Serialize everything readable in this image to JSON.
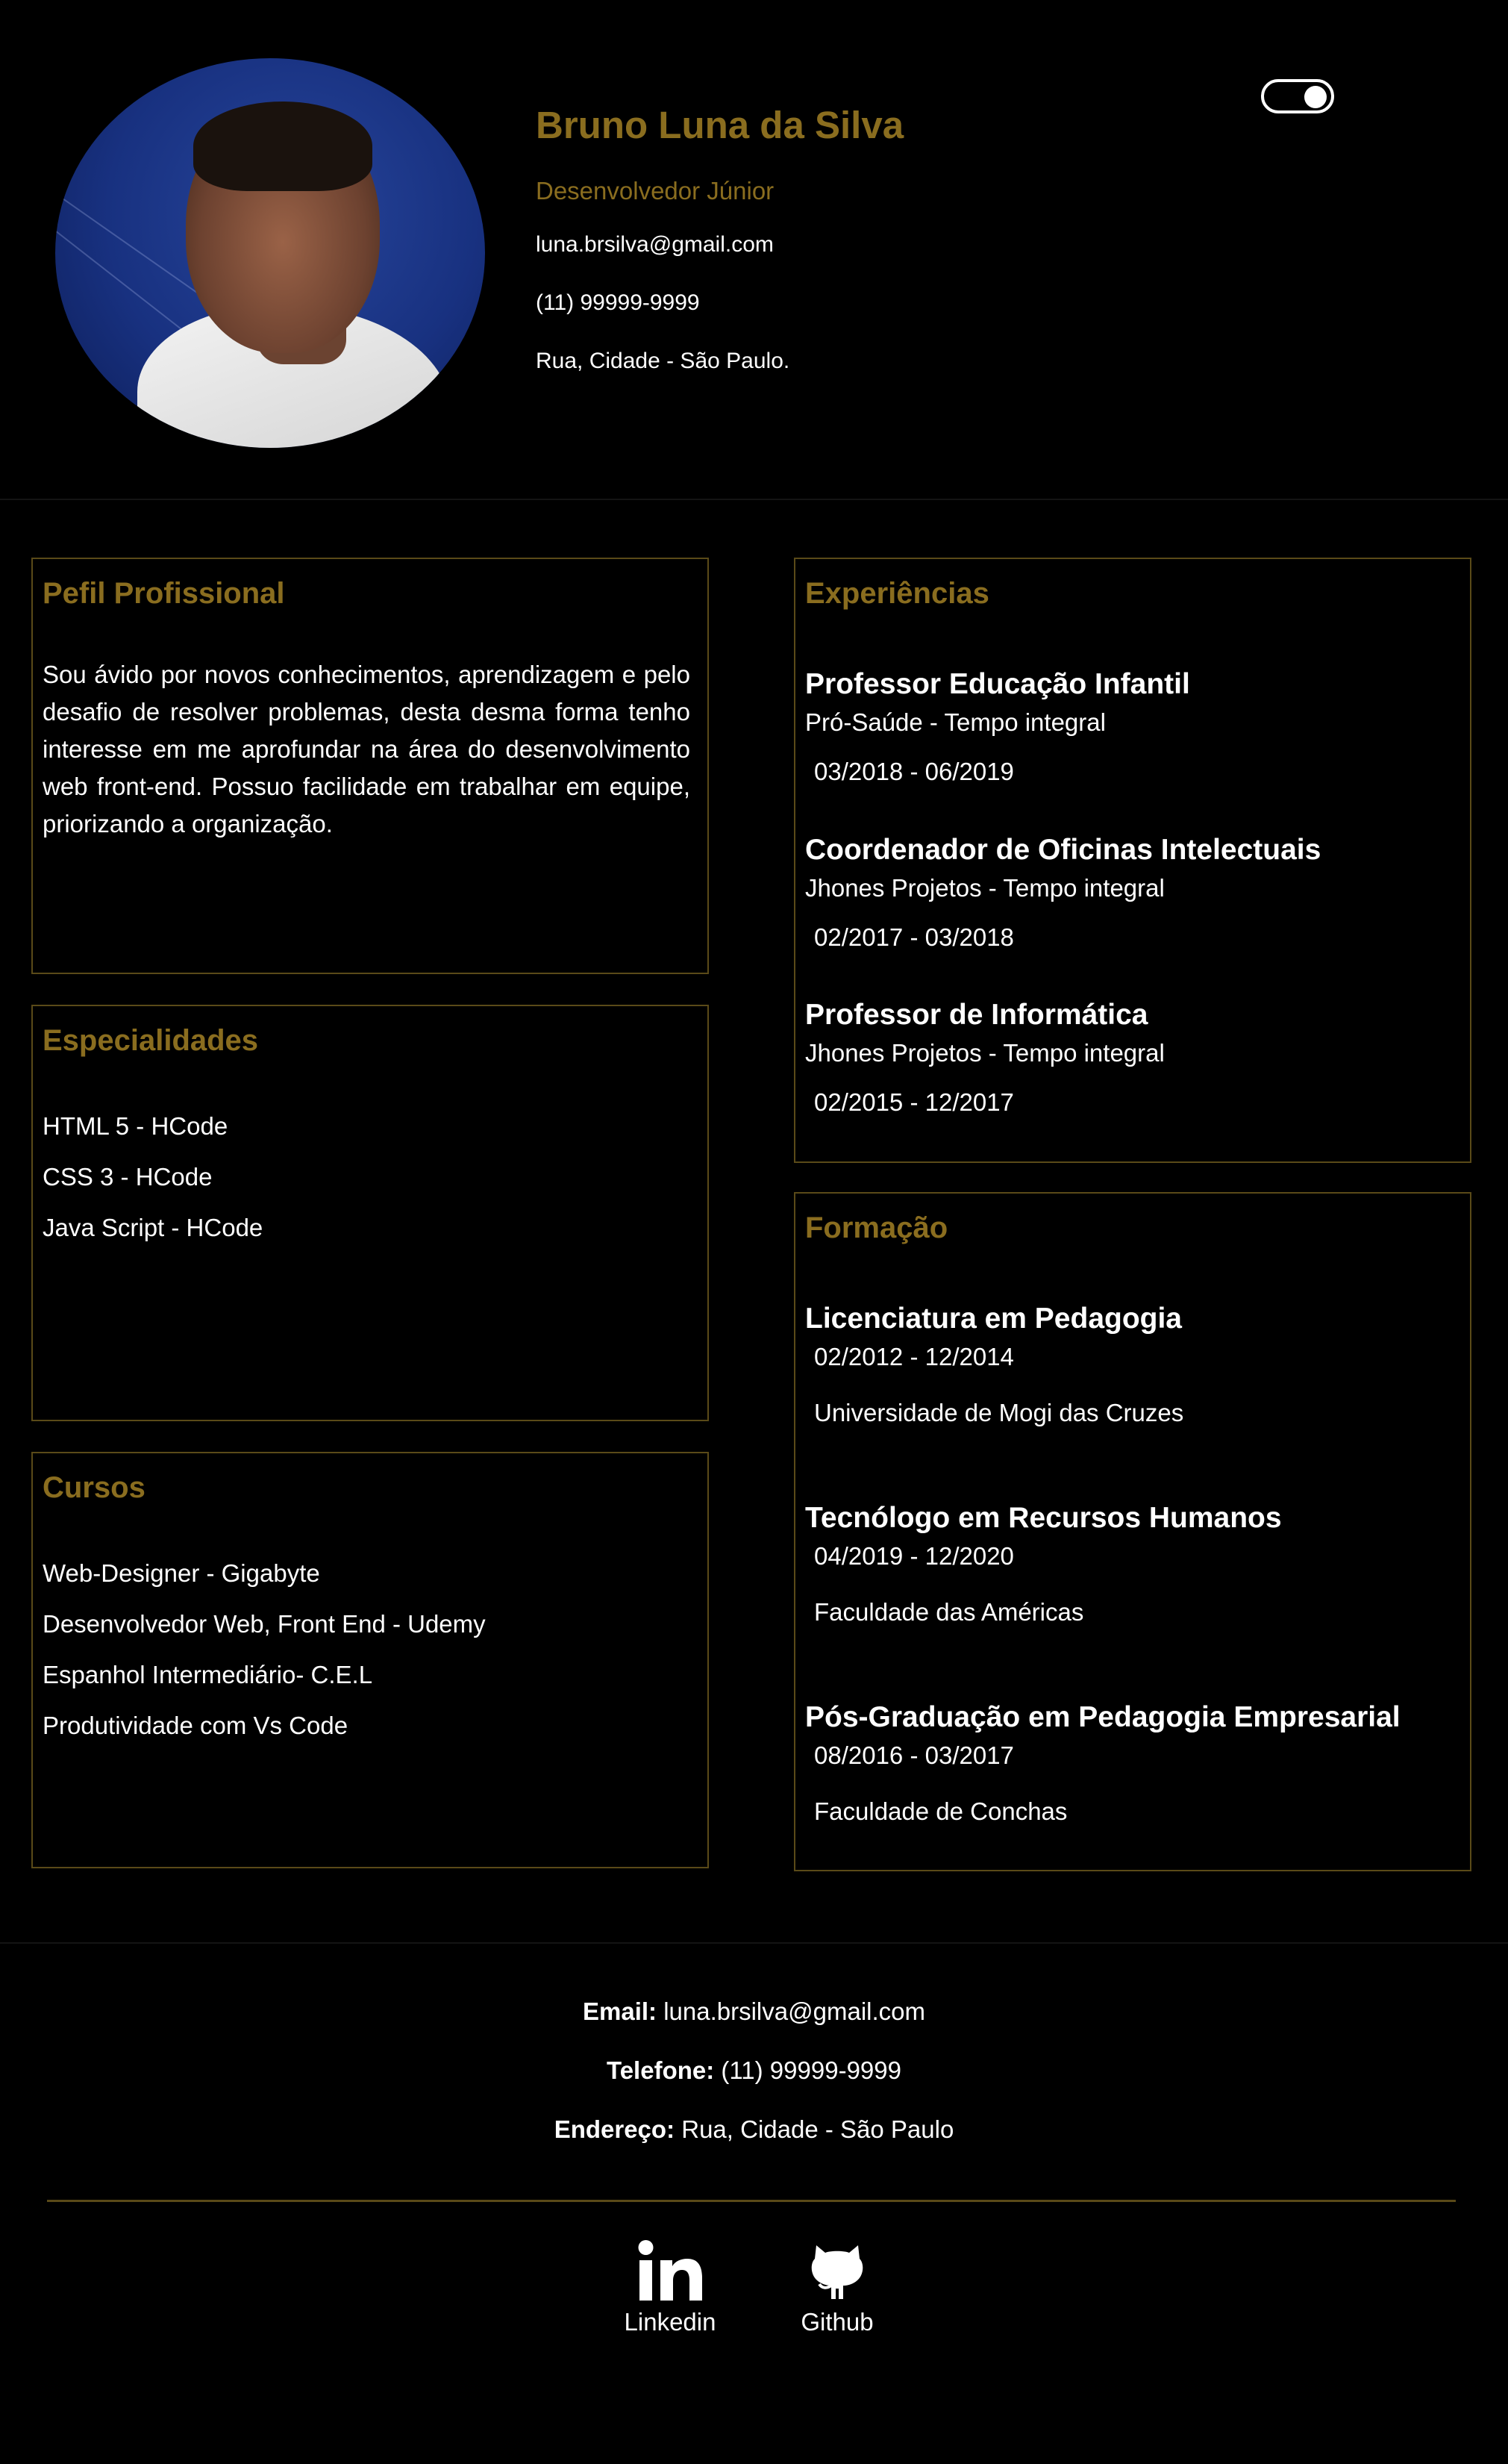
{
  "header": {
    "name": "Bruno Luna da Silva",
    "role": "Desenvolvedor Júnior",
    "email": "luna.brsilva@gmail.com",
    "phone": "(11) 99999-9999",
    "address": "Rua, Cidade - São Paulo.",
    "theme_toggle": "on"
  },
  "profile": {
    "title": "Pefil Profissional",
    "text": "Sou ávido por novos conhecimentos, aprendizagem e pelo desafio de resolver problemas, desta desma forma tenho interesse em me aprofundar na área do desenvolvimento web front-end. Possuo facilidade em trabalhar em equipe, priorizando a organização."
  },
  "specialties": {
    "title": "Especialidades",
    "items": [
      "HTML 5 - HCode",
      "CSS 3 - HCode",
      "Java Script - HCode"
    ]
  },
  "courses": {
    "title": "Cursos",
    "items": [
      "Web-Designer - Gigabyte",
      "Desenvolvedor Web, Front End - Udemy",
      "Espanhol Intermediário- C.E.L",
      "Produtividade com Vs Code"
    ]
  },
  "experience": {
    "title": "Experiências",
    "jobs": [
      {
        "title": "Professor Educação Infantil",
        "company": "Pró-Saúde - Tempo integral",
        "period": "03/2018 - 06/2019"
      },
      {
        "title": "Coordenador de Oficinas Intelectuais",
        "company": "Jhones Projetos - Tempo integral",
        "period": "02/2017 - 03/2018"
      },
      {
        "title": "Professor de Informática",
        "company": "Jhones Projetos - Tempo integral",
        "period": "02/2015 - 12/2017"
      }
    ]
  },
  "education": {
    "title": "Formação",
    "items": [
      {
        "title": "Licenciatura em Pedagogia",
        "period": "02/2012 - 12/2014",
        "school": "Universidade de Mogi das Cruzes"
      },
      {
        "title": "Tecnólogo em Recursos Humanos",
        "period": "04/2019 - 12/2020",
        "school": "Faculdade das Américas"
      },
      {
        "title": "Pós-Graduação em Pedagogia Empresarial",
        "period": "08/2016 - 03/2017",
        "school": "Faculdade de Conchas"
      }
    ]
  },
  "footer": {
    "email_label": "Email:",
    "email": "luna.brsilva@gmail.com",
    "phone_label": "Telefone:",
    "phone": "(11) 99999-9999",
    "address_label": "Endereço:",
    "address": "Rua, Cidade - São Paulo",
    "social": [
      {
        "label": "Linkedin",
        "icon": "linkedin-icon"
      },
      {
        "label": "Github",
        "icon": "github-icon"
      }
    ]
  },
  "colors": {
    "accent": "#8a6d1f",
    "background": "#000000",
    "border": "#5a4a18",
    "text": "#ffffff"
  }
}
